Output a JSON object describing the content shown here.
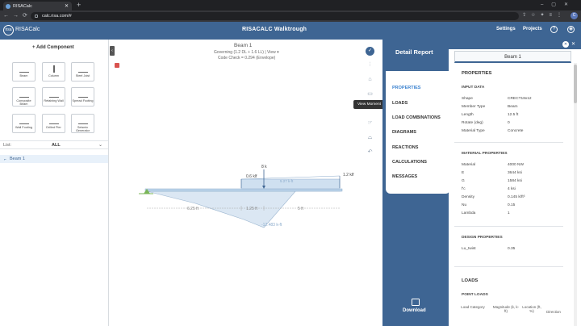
{
  "browser": {
    "tab_title": "RISACalc",
    "url": "calc.risa.com/#",
    "profile_initial": "C"
  },
  "app": {
    "logo_text": "risa",
    "brand": "RISACalc",
    "title": "RISACALC Walktrough",
    "settings": "Settings",
    "projects": "Projects"
  },
  "left": {
    "add_component": "Add Component",
    "components": [
      {
        "label": "Beam"
      },
      {
        "label": "Column"
      },
      {
        "label": "Steel Joist"
      },
      {
        "label": "Composite Beam"
      },
      {
        "label": "Retaining Wall"
      },
      {
        "label": "Spread Footing"
      },
      {
        "label": "Wall Footing"
      },
      {
        "label": "Drilled Pier"
      },
      {
        "label": "Seismic Generator"
      }
    ],
    "list_label": "List:",
    "list_value": "ALL",
    "items": [
      {
        "label": "Beam 1"
      }
    ]
  },
  "canvas": {
    "title": "Beam 1",
    "governing": "Governing (1.2 DL + 1.6 LL) | View ▾",
    "code_check": "Code Check = 0.294 (Envelope)",
    "loads": {
      "point": "8 k",
      "dist_left": "0.6 klf",
      "dist_right": "1.2 klf",
      "moment_max": "5.27 k-ft"
    },
    "dims": [
      "6.25 ft",
      "1.25 ft",
      "5 ft"
    ],
    "moment_min": "-12.483 k-ft",
    "tooltip": "View Moment"
  },
  "detail": {
    "header": "Detail Report",
    "nav": [
      "PROPERTIES",
      "LOADS",
      "LOAD COMBINATIONS",
      "DIAGRAMS",
      "REACTIONS",
      "CALCULATIONS",
      "MESSAGES"
    ],
    "download": "Download"
  },
  "report": {
    "beam_name": "Beam 1",
    "properties_title": "PROPERTIES",
    "input_data_title": "INPUT DATA",
    "input_data": [
      {
        "k": "Shape",
        "v": "CRECT18x12"
      },
      {
        "k": "Member Type",
        "v": "Beam"
      },
      {
        "k": "Length",
        "v": "12.5 ft"
      },
      {
        "k": "Rotate (deg)",
        "v": "0"
      },
      {
        "k": "Material Type",
        "v": "Concrete"
      }
    ],
    "material_title": "MATERIAL PROPERTIES",
    "material": [
      {
        "k": "Material",
        "v": "4000 NW"
      },
      {
        "k": "E",
        "v": "3644 ksi"
      },
      {
        "k": "G",
        "v": "1584 ksi"
      },
      {
        "k": "f'c",
        "v": "4 ksi"
      },
      {
        "k": "Density",
        "v": "0.145 k/ft³"
      },
      {
        "k": "Nu",
        "v": "0.15"
      },
      {
        "k": "Lambda",
        "v": "1"
      }
    ],
    "design_title": "DESIGN PROPERTIES",
    "design": [
      {
        "k": "Lu_twist",
        "v": "0.35"
      }
    ],
    "loads_title": "LOADS",
    "point_loads_title": "POINT LOADS",
    "point_headers": [
      "Load Category",
      "Magnitude (k, k-ft)",
      "Location (ft, %)",
      "Direction"
    ]
  }
}
